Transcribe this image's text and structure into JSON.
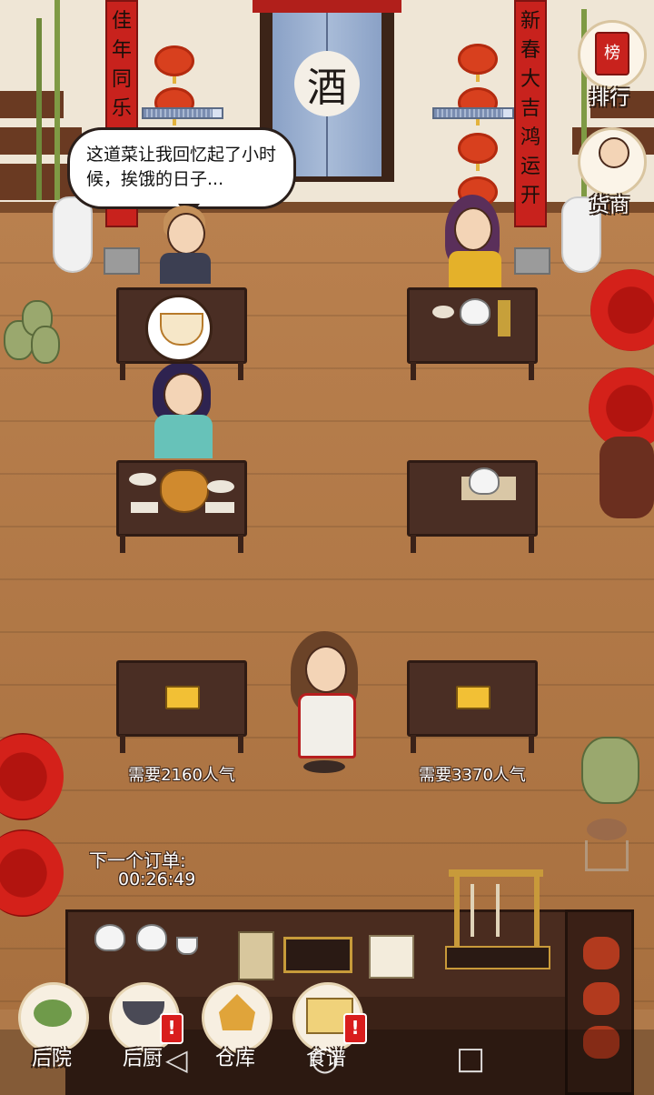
{
  "scene": {
    "wine_sign": "酒",
    "couplet_left": "佳年同乐",
    "couplet_right": "新春大吉鸿运开",
    "speech_bubble": "这道菜让我回忆起了小时候，挨饿的日子...",
    "hp_left": 0.88,
    "hp_right": 0.88
  },
  "tables": [
    {
      "state": "occupied",
      "requirement": ""
    },
    {
      "state": "occupied",
      "requirement": ""
    },
    {
      "state": "occupied",
      "requirement": ""
    },
    {
      "state": "occupied",
      "requirement": ""
    },
    {
      "state": "locked",
      "requirement": "需要2160人气"
    },
    {
      "state": "locked",
      "requirement": "需要3370人气"
    }
  ],
  "order": {
    "label": "下一个订单:",
    "countdown": "00:26:49"
  },
  "side_buttons": {
    "ranking": "排行",
    "merchant": "货商",
    "ranking_icon_text": "榜"
  },
  "nav": {
    "backyard": "后院",
    "kitchen": "后厨",
    "warehouse": "仓库",
    "recipes": "食谱",
    "badge": "!"
  },
  "system_nav": {
    "back": "◁",
    "home": "○",
    "recent": "□"
  },
  "colors": {
    "floor": "#b07a4a",
    "couplet": "#c8221d",
    "badge": "#d91d1d"
  }
}
